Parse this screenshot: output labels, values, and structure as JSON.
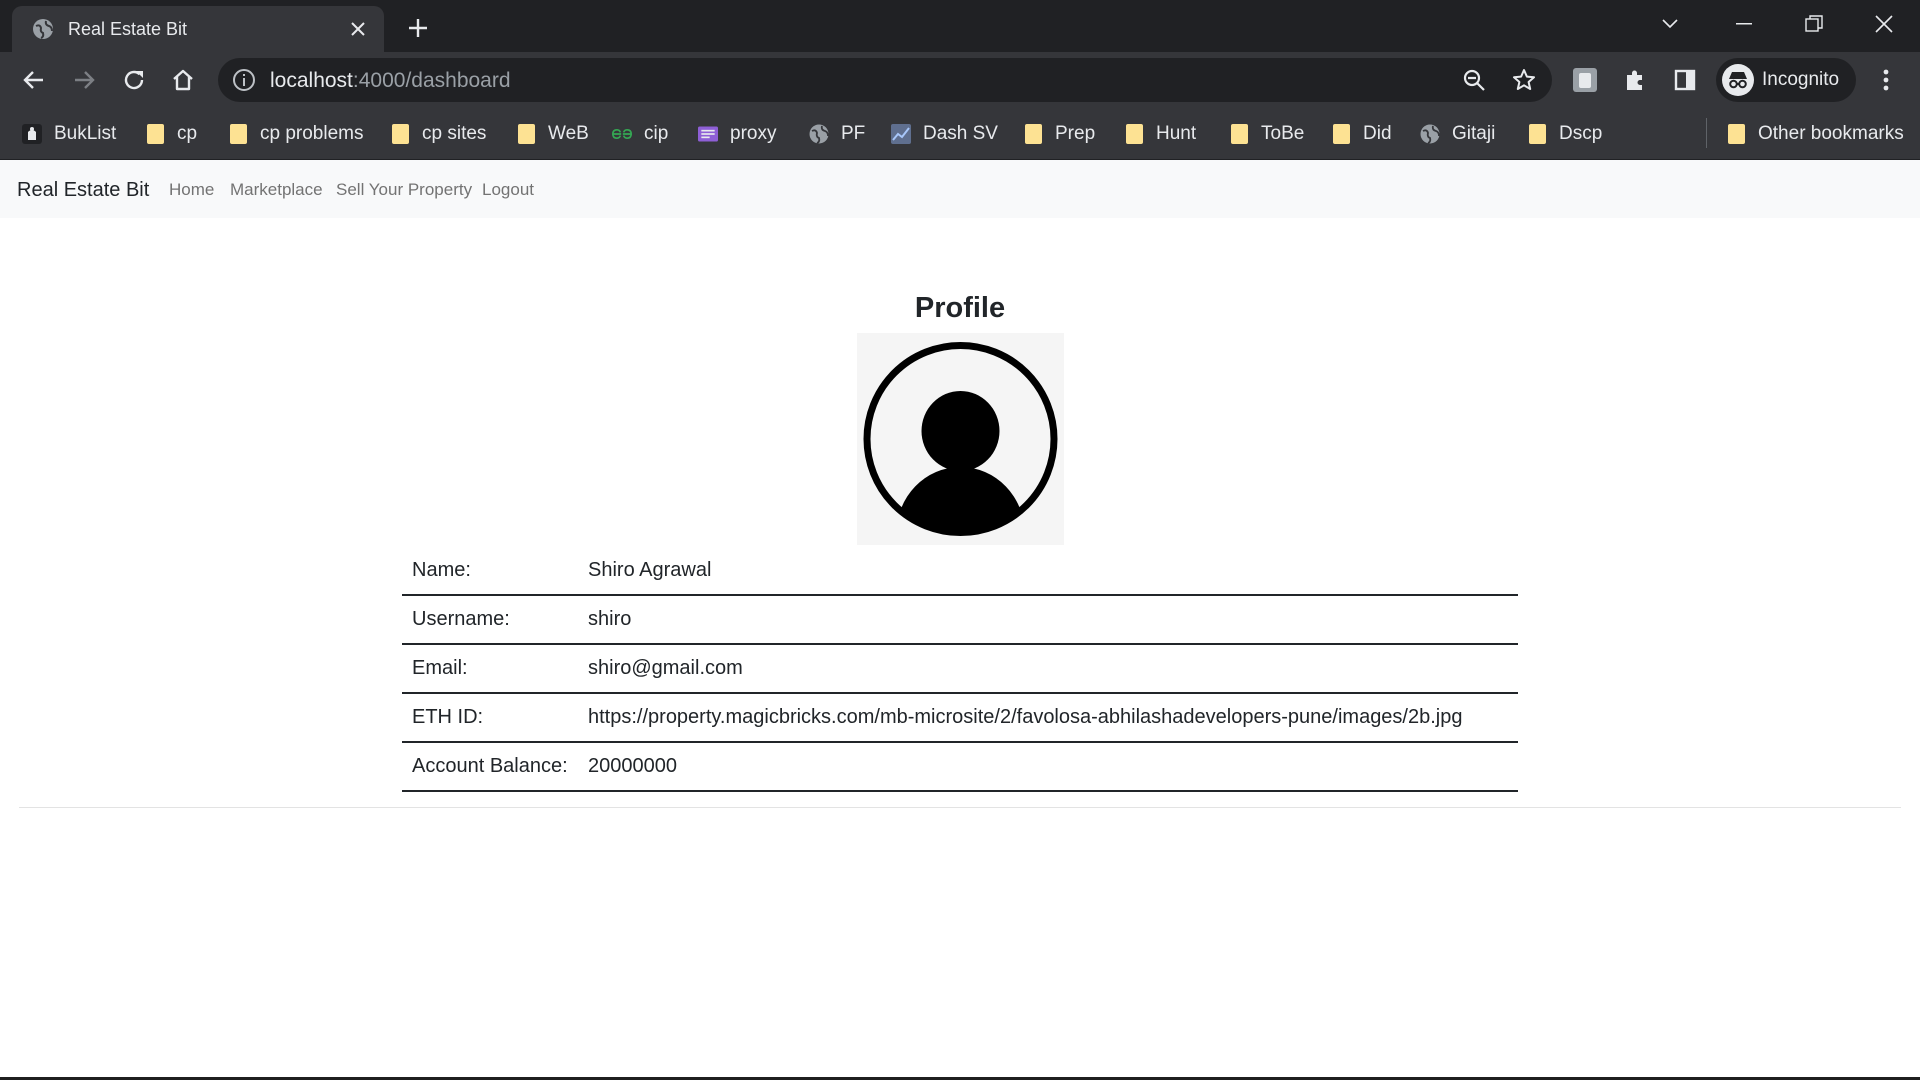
{
  "browser": {
    "tab": {
      "title": "Real Estate Bit",
      "favicon": "globe-icon"
    },
    "address": {
      "host": "localhost",
      "path": ":4000/dashboard"
    },
    "profile": {
      "label": "Incognito",
      "icon": "incognito-icon"
    },
    "bookmarks": [
      {
        "label": "BukList",
        "icon": "buklist-icon"
      },
      {
        "label": "cp",
        "icon": "folder-icon"
      },
      {
        "label": "cp problems",
        "icon": "folder-icon"
      },
      {
        "label": "cp sites",
        "icon": "folder-icon"
      },
      {
        "label": "WeB",
        "icon": "folder-icon"
      },
      {
        "label": "cip",
        "icon": "geeksforgeeks-icon"
      },
      {
        "label": "proxy",
        "icon": "list-icon"
      },
      {
        "label": "PF",
        "icon": "globe-icon"
      },
      {
        "label": "Dash SV",
        "icon": "chart-icon"
      },
      {
        "label": "Prep",
        "icon": "folder-icon"
      },
      {
        "label": "Hunt",
        "icon": "folder-icon"
      },
      {
        "label": "ToBe",
        "icon": "folder-icon"
      },
      {
        "label": "Did",
        "icon": "folder-icon"
      },
      {
        "label": "Gitaji",
        "icon": "globe-icon"
      },
      {
        "label": "Dscp",
        "icon": "folder-icon"
      }
    ],
    "other_bookmarks": "Other bookmarks",
    "colors": {
      "frame": "#202124",
      "toolbar": "#35363a",
      "text": "#e8eaed",
      "folder": "#fde293"
    }
  },
  "navbar": {
    "brand": "Real Estate Bit",
    "links": [
      "Home",
      "Marketplace",
      "Sell Your Property",
      "Logout"
    ]
  },
  "profile": {
    "title": "Profile",
    "avatar_icon": "user-avatar-icon",
    "rows": [
      {
        "label": "Name:",
        "value": "Shiro Agrawal"
      },
      {
        "label": "Username:",
        "value": "shiro"
      },
      {
        "label": "Email:",
        "value": "shiro@gmail.com"
      },
      {
        "label": "ETH ID:",
        "value": "https://property.magicbricks.com/mb-microsite/2/favolosa-abhilashadevelopers-pune/images/2b.jpg"
      },
      {
        "label": "Account Balance:",
        "value": "20000000"
      }
    ]
  }
}
